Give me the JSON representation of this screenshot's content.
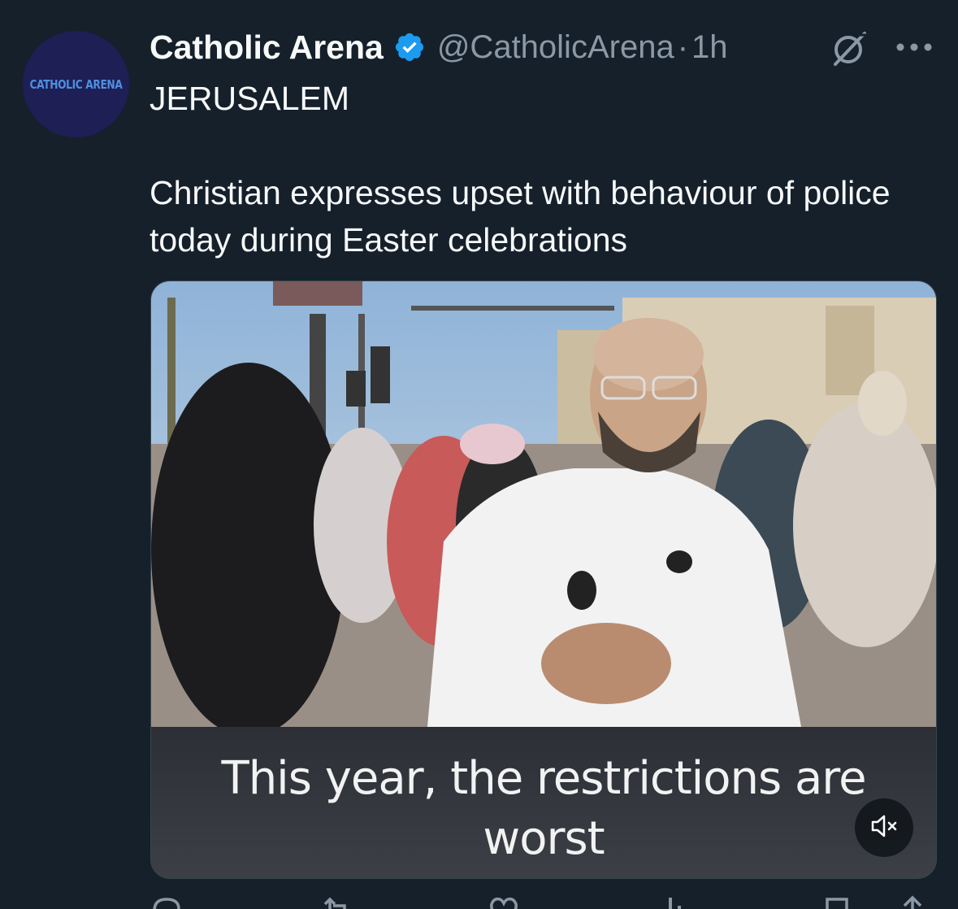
{
  "author": {
    "avatar_text": "CATHOLIC ARENA",
    "display_name": "Catholic Arena",
    "handle": "@CatholicArena",
    "separator": "·",
    "time": "1h",
    "verified": true
  },
  "tweet": {
    "line1": "JERUSALEM",
    "line2": "Christian expresses upset with behaviour of police today during Easter celebrations"
  },
  "media": {
    "type": "video",
    "subtitle_line1": "This year, the restrictions are",
    "subtitle_line2": "worst",
    "muted": true
  },
  "icons": {
    "verified": "verified-badge-icon",
    "grok": "grok-icon",
    "more": "more-options-icon",
    "mute": "volume-muted-icon",
    "reply": "reply-icon",
    "retweet": "retweet-icon",
    "like": "like-icon",
    "views": "views-icon",
    "bookmark": "bookmark-icon",
    "share": "share-icon"
  },
  "colors": {
    "background": "#15202b",
    "accent": "#1d9bf0",
    "secondary_text": "#8b98a5"
  }
}
